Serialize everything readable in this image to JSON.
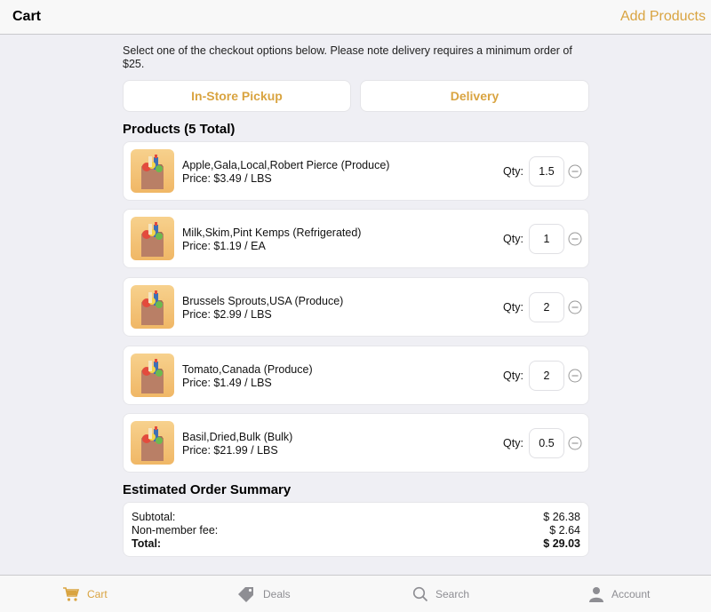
{
  "nav": {
    "title": "Cart",
    "action_label": "Add Products"
  },
  "notice": "Select one of the checkout options below. Please note delivery requires a minimum order of $25.",
  "checkout_options": {
    "pickup_label": "In-Store Pickup",
    "delivery_label": "Delivery"
  },
  "products_title": "Products (5 Total)",
  "qty_label": "Qty:",
  "products": [
    {
      "name": "Apple,Gala,Local,Robert Pierce (Produce)",
      "price": "Price: $3.49 / LBS",
      "qty": "1.5"
    },
    {
      "name": "Milk,Skim,Pint Kemps (Refrigerated)",
      "price": "Price: $1.19 / EA",
      "qty": "1"
    },
    {
      "name": "Brussels Sprouts,USA (Produce)",
      "price": "Price: $2.99 / LBS",
      "qty": "2"
    },
    {
      "name": "Tomato,Canada (Produce)",
      "price": "Price: $1.49 / LBS",
      "qty": "2"
    },
    {
      "name": "Basil,Dried,Bulk (Bulk)",
      "price": "Price: $21.99 / LBS",
      "qty": "0.5"
    }
  ],
  "summary": {
    "title": "Estimated Order Summary",
    "subtotal_label": "Subtotal:",
    "subtotal_value": "$ 26.38",
    "fee_label": "Non-member fee:",
    "fee_value": "$ 2.64",
    "total_label": "Total:",
    "total_value": "$ 29.03"
  },
  "tabs": [
    {
      "label": "Cart",
      "icon": "cart-icon",
      "active": true
    },
    {
      "label": "Deals",
      "icon": "tag-icon",
      "active": false
    },
    {
      "label": "Search",
      "icon": "search-icon",
      "active": false
    },
    {
      "label": "Account",
      "icon": "person-icon",
      "active": false
    }
  ],
  "colors": {
    "accent": "#d9a441",
    "inactive": "#8e8e93",
    "background": "#efeff4"
  }
}
